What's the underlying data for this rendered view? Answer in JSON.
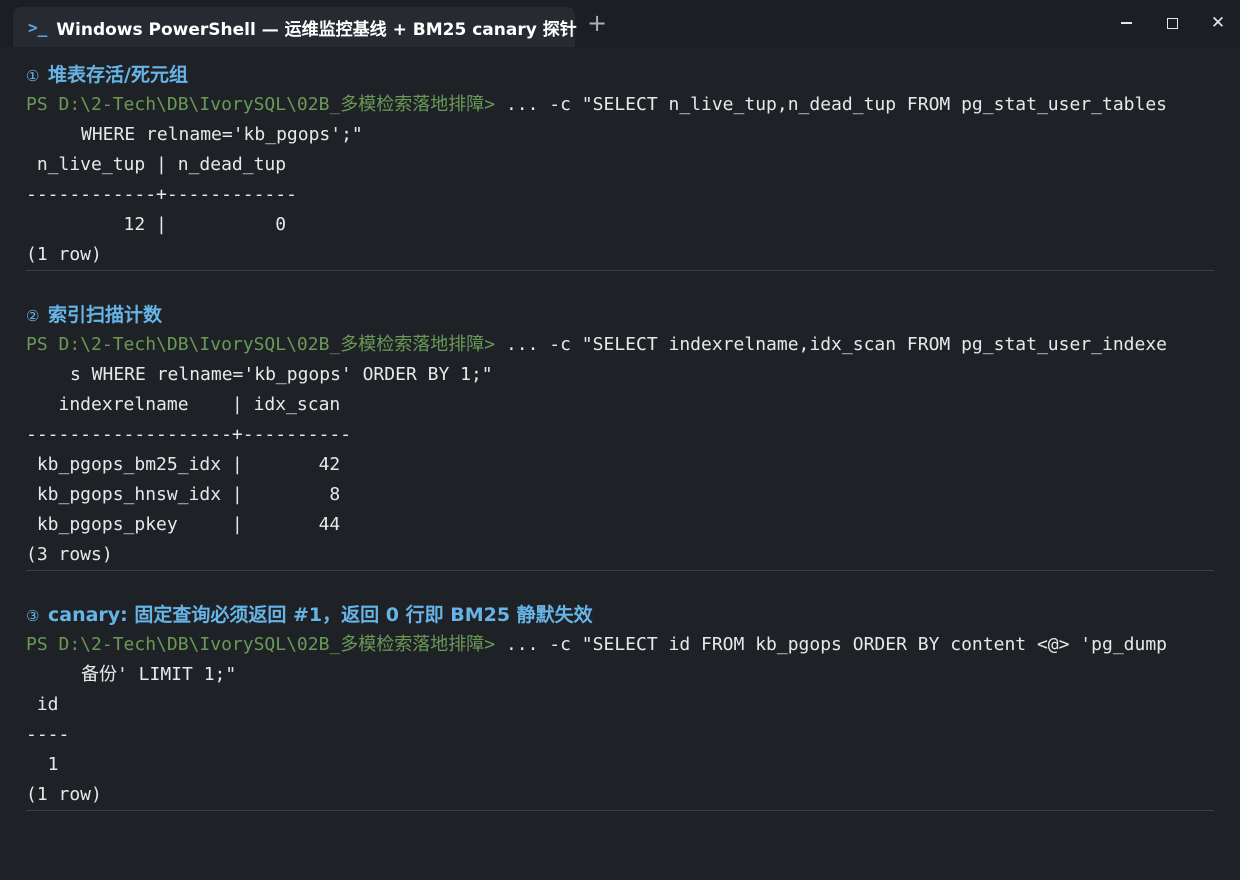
{
  "window": {
    "tab_icon": ">_",
    "tab_title": "Windows PowerShell — 运维监控基线 + BM25 canary 探针",
    "new_tab_symbol": "+",
    "controls": [
      "minimize-icon",
      "maximize-icon",
      "close-icon"
    ],
    "close_symbol": "✕"
  },
  "colors": {
    "background": "#1e2227",
    "heading": "#67b4e6",
    "prompt": "#6a9955",
    "text": "#e8e8e8"
  },
  "sections": [
    {
      "num": "①",
      "heading": "堆表存活/死元组",
      "prompt": "PS D:\\2-Tech\\DB\\IvorySQL\\02B_多模检索落地排障>",
      "command": " ... -c \"SELECT n_live_tup,n_dead_tup FROM pg_stat_user_tables",
      "command_cont": "WHERE relname='kb_pgops';\"",
      "output": [
        " n_live_tup | n_dead_tup",
        "------------+------------",
        "         12 |          0",
        "(1 row)"
      ]
    },
    {
      "num": "②",
      "heading": "索引扫描计数",
      "prompt": "PS D:\\2-Tech\\DB\\IvorySQL\\02B_多模检索落地排障>",
      "command": " ... -c \"SELECT indexrelname,idx_scan FROM pg_stat_user_indexe",
      "command_cont": "s WHERE relname='kb_pgops' ORDER BY 1;\"",
      "output": [
        "   indexrelname    | idx_scan",
        "-------------------+----------",
        " kb_pgops_bm25_idx |       42",
        " kb_pgops_hnsw_idx |        8",
        " kb_pgops_pkey     |       44",
        "(3 rows)"
      ]
    },
    {
      "num": "③",
      "heading": "canary: 固定查询必须返回 #1，返回 0 行即 BM25 静默失效",
      "prompt": "PS D:\\2-Tech\\DB\\IvorySQL\\02B_多模检索落地排障>",
      "command": " ... -c \"SELECT id FROM kb_pgops ORDER BY content <@> 'pg_dump",
      "command_cont": "备份' LIMIT 1;\"",
      "output": [
        " id",
        "----",
        "  1",
        "(1 row)"
      ]
    }
  ]
}
